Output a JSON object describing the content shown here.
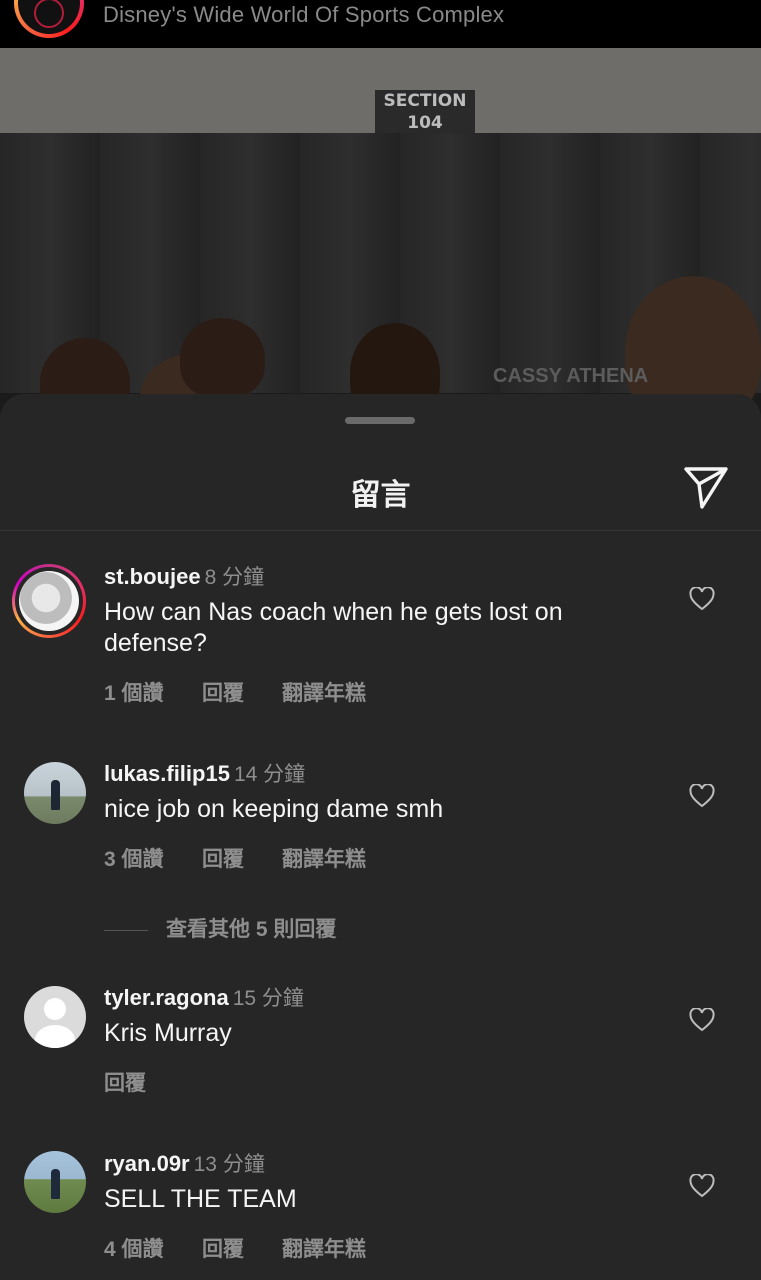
{
  "header": {
    "location": "Disney's Wide World Of Sports Complex"
  },
  "photo": {
    "sign_text": "SECTION 104",
    "watermark": "CASSY ATHENA"
  },
  "sheet": {
    "title": "留言",
    "share_icon": "paper-plane-icon"
  },
  "comments": [
    {
      "username": "st.boujee",
      "time": "8 分鐘",
      "text": "How can Nas coach when he gets lost on defense?",
      "likes": "1 個讚",
      "reply": "回覆",
      "translate": "翻譯年糕"
    },
    {
      "username": "lukas.filip15",
      "time": "14 分鐘",
      "text": "nice job on keeping dame smh",
      "likes": "3 個讚",
      "reply": "回覆",
      "translate": "翻譯年糕",
      "more_replies": "查看其他 5 則回覆"
    },
    {
      "username": "tyler.ragona",
      "time": "15 分鐘",
      "text": "Kris Murray",
      "reply": "回覆"
    },
    {
      "username": "ryan.09r",
      "time": "13 分鐘",
      "text": "SELL THE TEAM",
      "likes": "4 個讚",
      "reply": "回覆",
      "translate": "翻譯年糕"
    }
  ],
  "icons": {
    "like": "heart-icon"
  }
}
